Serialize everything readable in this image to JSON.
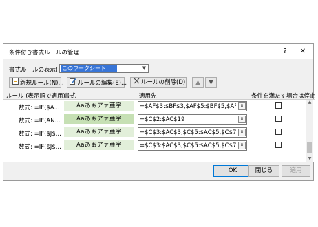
{
  "window": {
    "title": "条件付き書式ルールの管理",
    "help_label": "?",
    "close_label": "✕"
  },
  "show_rules": {
    "label": "書式ルールの表示(S):",
    "selected": "このワークシート"
  },
  "toolbar": {
    "new_rule": "新規ルール(N)...",
    "edit_rule": "ルールの編集(E)...",
    "delete_rule": "ルールの削除(D)"
  },
  "columns": {
    "rule": "ルール (表示順で適用)",
    "format": "書式",
    "applies_to": "適用先",
    "stop_if_true": "条件を満たす場合は停止"
  },
  "rules": [
    {
      "rule": "数式: =IF($A...",
      "format_preview": "Aaあぁアァ亜宇",
      "fill": "#e2efda",
      "applies_to": "=$AF$3:$BF$3,$AF$5:$BF$5,$AF$7:",
      "stop": false
    },
    {
      "rule": "数式: =IF(AN...",
      "format_preview": "Aaあぁアァ亜宇",
      "fill": "#c6e0b4",
      "applies_to": "=$C$2:$AC$19",
      "stop": false
    },
    {
      "rule": "数式: =IF($J$...",
      "format_preview": "Aaあぁアァ亜宇",
      "fill": "#e2efda",
      "applies_to": "=$C$3:$AC$3,$C$5:$AC$5,$C$7:$AC",
      "stop": false
    },
    {
      "rule": "数式: =IF($J$...",
      "format_preview": "Aaあぁアァ亜宇",
      "fill": "#e2efda",
      "applies_to": "=$C$3:$AC$3,$C$5:$AC$5,$C$7:$AC",
      "stop": false
    }
  ],
  "footer": {
    "ok": "OK",
    "close": "閉じる",
    "apply": "適用"
  }
}
